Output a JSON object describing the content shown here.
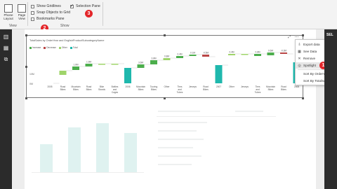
{
  "ribbon": {
    "buttons": [
      {
        "label": "Phone Layout",
        "icon": "phone-layout-icon"
      },
      {
        "label": "Page View",
        "icon": "page-view-icon"
      }
    ],
    "view_group_label": "View",
    "show_group_label": "Show",
    "checkboxes": [
      {
        "label": "Show Gridlines",
        "checked": false
      },
      {
        "label": "Snap Objects to Grid",
        "checked": false
      },
      {
        "label": "Bookmarks Pane",
        "checked": false
      },
      {
        "label": "Selection Pane",
        "checked": true
      }
    ]
  },
  "badges": {
    "b1": "1",
    "b2": "2",
    "b3": "3"
  },
  "right_pane": {
    "label": "SEL"
  },
  "chart_data": {
    "type": "bar",
    "title": "TotalSales by OrderYear and EnglishProductSubcategoryName",
    "legend": [
      {
        "name": "Increase",
        "color": "#4cae4c"
      },
      {
        "name": "Decrease",
        "color": "#b94646"
      },
      {
        "name": "Other",
        "color": "#9fd46a"
      },
      {
        "name": "Total",
        "color": "#1fb8ad"
      }
    ],
    "categories": [
      "2005",
      "Road Bikes",
      "Mountain Bikes",
      "Road Bikes",
      "Bike Stands",
      "Bottles and Cages",
      "2006",
      "Mountain Bikes",
      "Touring Bikes",
      "Other",
      "Tires and Tubes",
      "Jerseys",
      "Road Bikes",
      "2007",
      "Other",
      "Jerseys",
      "Tires and Tubes",
      "Mountain Bikes",
      "Road Bikes",
      "2008"
    ],
    "value_labels": [
      "",
      "",
      "1.6M",
      "1.9M",
      "",
      "",
      "",
      "3.6M",
      "3.8M",
      "0.8M",
      "0.4M",
      "0.1M",
      "-0.5M",
      "",
      "0.4M",
      "",
      "0.8M",
      "0.6M",
      "-0.3M",
      ""
    ],
    "kinds": [
      "total",
      "other",
      "increase",
      "increase",
      "other",
      "other",
      "total",
      "increase",
      "increase",
      "other",
      "increase",
      "increase",
      "decrease",
      "total",
      "other",
      "other",
      "increase",
      "increase",
      "decrease",
      "total"
    ],
    "y_tick_labels": [
      "10M",
      "0M"
    ]
  },
  "context_menu": {
    "items": [
      {
        "label": "Export data",
        "icon": "export-icon"
      },
      {
        "label": "See Data",
        "icon": "table-icon"
      },
      {
        "label": "Remove",
        "icon": "close-icon"
      },
      {
        "label": "Spotlight",
        "icon": "spotlight-icon"
      },
      {
        "label": "Sort By OrderYear",
        "icon": ""
      },
      {
        "label": "Sort By TotalSales",
        "icon": ""
      }
    ]
  }
}
